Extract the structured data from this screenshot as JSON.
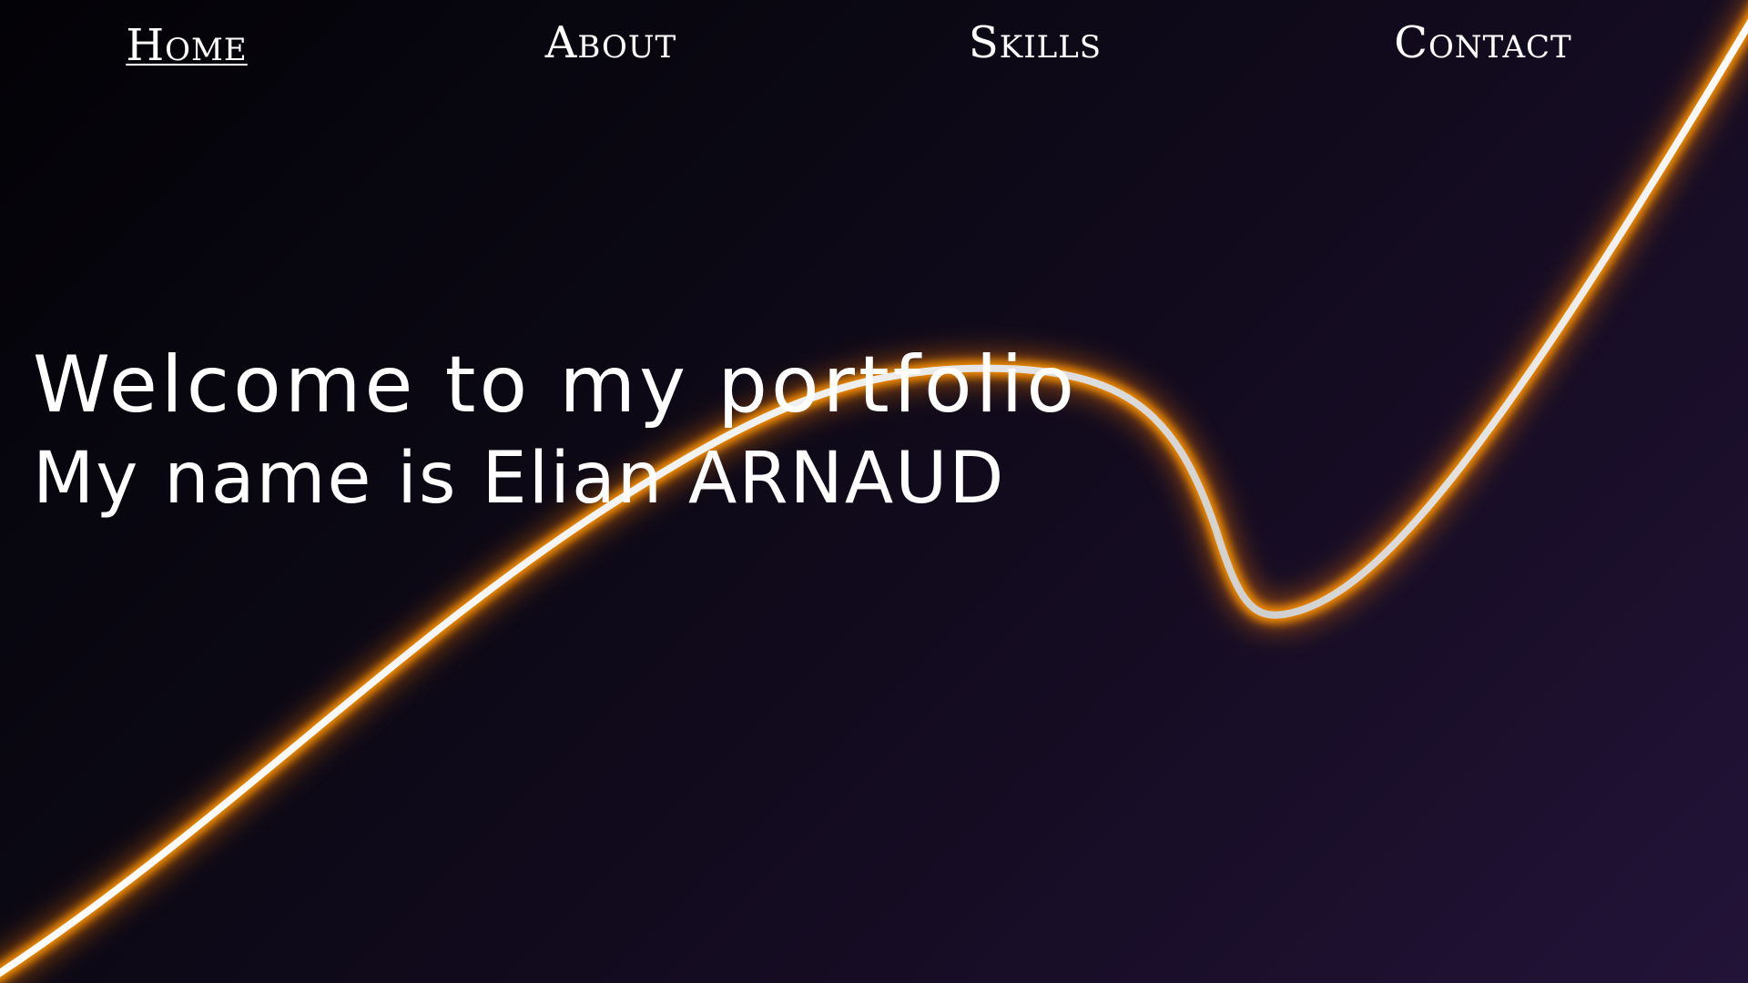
{
  "navigation": {
    "items": [
      {
        "label": "Home",
        "active": true
      },
      {
        "label": "About",
        "active": false
      },
      {
        "label": "Skills",
        "active": false
      },
      {
        "label": "Contact",
        "active": false
      }
    ]
  },
  "hero": {
    "title": "Welcome to my portfolio",
    "subtitle": "My name is Elian ARNAUD"
  },
  "theme": {
    "background_dark": "#030206",
    "background_purple": "#221338",
    "curve_glow": "#ff8a00",
    "curve_core": "#ffffff"
  }
}
